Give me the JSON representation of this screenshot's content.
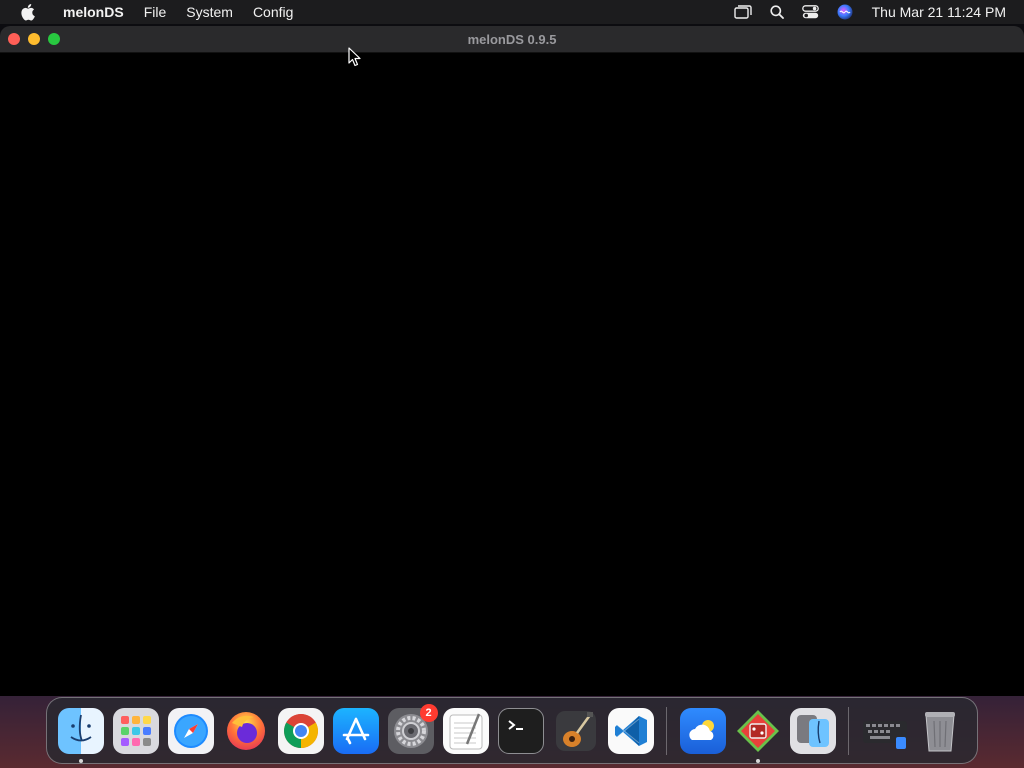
{
  "menubar": {
    "app_name": "melonDS",
    "items": [
      "File",
      "System",
      "Config"
    ],
    "clock": "Thu Mar 21  11:24 PM",
    "status_icons": [
      "screen-mirroring-icon",
      "search-icon",
      "control-center-icon",
      "siri-icon"
    ]
  },
  "window": {
    "title": "melonDS 0.9.5",
    "traffic_lights": {
      "close": "#ff5f57",
      "minimize": "#febc2e",
      "zoom": "#28c840"
    }
  },
  "dock": {
    "apps": [
      {
        "name": "finder",
        "running": true
      },
      {
        "name": "launchpad",
        "running": false
      },
      {
        "name": "safari",
        "running": false
      },
      {
        "name": "firefox",
        "running": false
      },
      {
        "name": "chrome",
        "running": false
      },
      {
        "name": "app-store",
        "running": false
      },
      {
        "name": "system-settings",
        "running": false,
        "badge": "2"
      },
      {
        "name": "textedit",
        "running": false
      },
      {
        "name": "terminal",
        "running": false
      },
      {
        "name": "garageband",
        "running": false
      },
      {
        "name": "vscode",
        "running": false
      }
    ],
    "recent": [
      {
        "name": "weather",
        "running": false
      },
      {
        "name": "melonds",
        "running": true
      },
      {
        "name": "migration-assistant",
        "running": false
      }
    ],
    "other": [
      {
        "name": "keyboard-viewer"
      },
      {
        "name": "trash"
      }
    ]
  }
}
